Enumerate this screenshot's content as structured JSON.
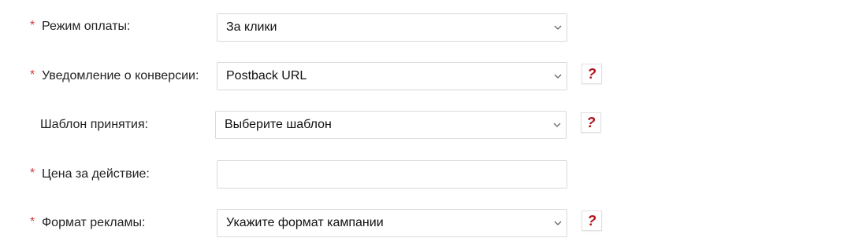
{
  "form": {
    "fields": [
      {
        "label": "Режим оплаты:",
        "required": "*",
        "value": "За клики",
        "kind": "select"
      },
      {
        "label": "Уведомление о конверсии:",
        "required": "*",
        "value": "Postback URL",
        "kind": "select",
        "help": "?"
      },
      {
        "label": "Шаблон принятия:",
        "value": "Выберите шаблон",
        "kind": "select",
        "help": "?"
      },
      {
        "label": "Цена за действие:",
        "required": "*",
        "value": "",
        "kind": "text-input"
      },
      {
        "label": "Формат рекламы:",
        "required": "*",
        "value": "Укажите формат кампании",
        "kind": "select",
        "help": "?"
      }
    ]
  },
  "colors": {
    "required_asterisk": "#d33a3a",
    "help_mark": "#b1121b",
    "border": "#d9d9d9"
  },
  "icons": {
    "dropdown": "chevron-down-icon",
    "help": "question-mark-icon"
  }
}
